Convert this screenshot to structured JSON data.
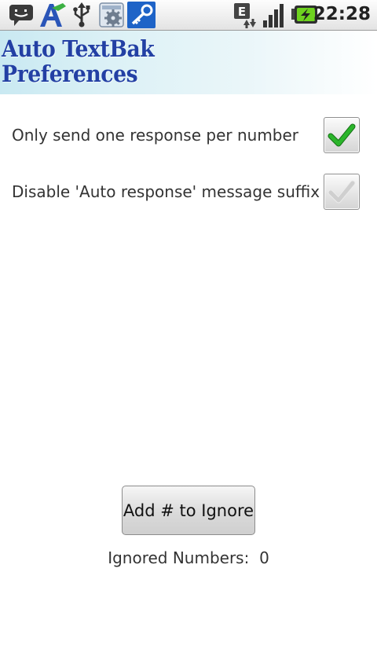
{
  "status_bar": {
    "time": "22:28",
    "notification_icons": [
      "chat-icon",
      "app-a-icon",
      "usb-icon",
      "settings-app-icon",
      "key-icon"
    ],
    "system_icons": [
      "edge-data-icon",
      "signal-icon",
      "battery-charging-icon"
    ]
  },
  "banner": {
    "line1": "Auto TextBak",
    "line2": "Preferences"
  },
  "preferences": [
    {
      "label": "Only send one response per number",
      "checked": true
    },
    {
      "label": "Disable 'Auto response' message suffix",
      "checked": false
    }
  ],
  "add_button_label": "Add # to Ignore",
  "ignored": {
    "label": "Ignored Numbers:",
    "count": "0"
  },
  "colors": {
    "banner_text": "#2340a4",
    "checkmark": "#2bb52b",
    "checkmark_off": "#cfcfcf"
  }
}
